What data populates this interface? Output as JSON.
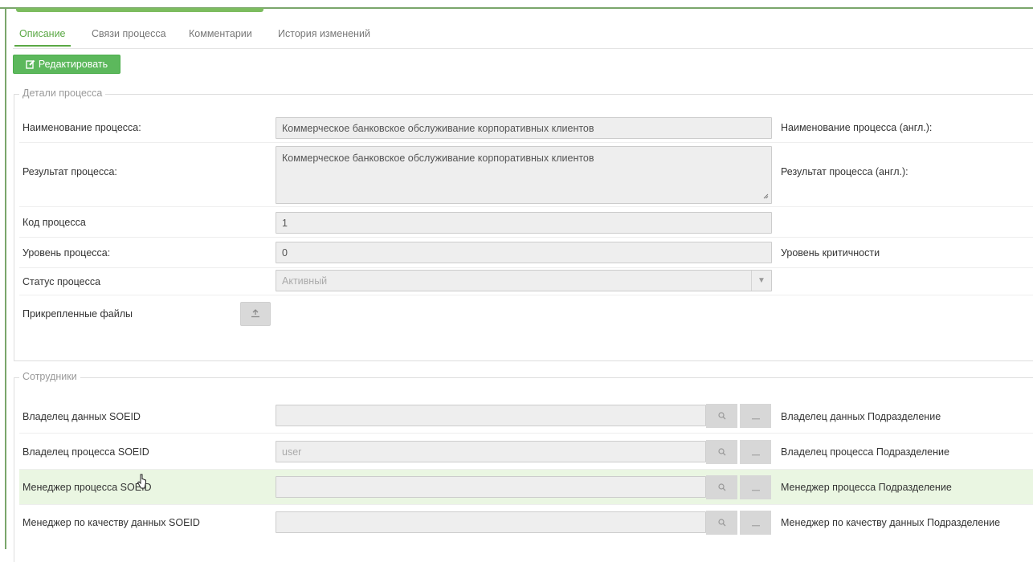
{
  "tabs": [
    {
      "label": "Описание",
      "active": true
    },
    {
      "label": "Связи процесса",
      "active": false
    },
    {
      "label": "Комментарии",
      "active": false
    },
    {
      "label": "История изменений",
      "active": false
    }
  ],
  "edit_button": {
    "label": "Редактировать",
    "icon": "edit-icon"
  },
  "details": {
    "legend": "Детали процесса",
    "name": {
      "label": "Наименование процесса:",
      "value": "Коммерческое банковское обслуживание корпоративных клиентов",
      "right_label": "Наименование процесса (англ.):"
    },
    "result": {
      "label": "Результат процесса:",
      "value": "Коммерческое банковское обслуживание корпоративных клиентов",
      "right_label": "Результат процесса (англ.):"
    },
    "code": {
      "label": "Код процесса",
      "value": "1"
    },
    "level": {
      "label": "Уровень процесса:",
      "value": "0",
      "right_label": "Уровень критичности"
    },
    "status": {
      "label": "Статус процесса",
      "value": "Активный"
    },
    "files": {
      "label": "Прикрепленные файлы",
      "icon": "upload-icon"
    }
  },
  "employees": {
    "legend": "Сотрудники",
    "rows": [
      {
        "label": "Владелец данных SOEID",
        "value": "",
        "right_label": "Владелец данных Подразделение"
      },
      {
        "label": "Владелец процесса SOEID",
        "value": "user",
        "right_label": "Владелец процесса Подразделение"
      },
      {
        "label": "Менеджер процесса SOEID",
        "value": "",
        "right_label": "Менеджер процесса Подразделение"
      },
      {
        "label": "Менеджер по качеству данных SOEID",
        "value": "",
        "right_label": "Менеджер по качеству данных Подразделение"
      }
    ]
  },
  "colors": {
    "accent": "#5cb85c",
    "highlight_row": "#eaf6e2",
    "frame": "#7aa66b"
  }
}
